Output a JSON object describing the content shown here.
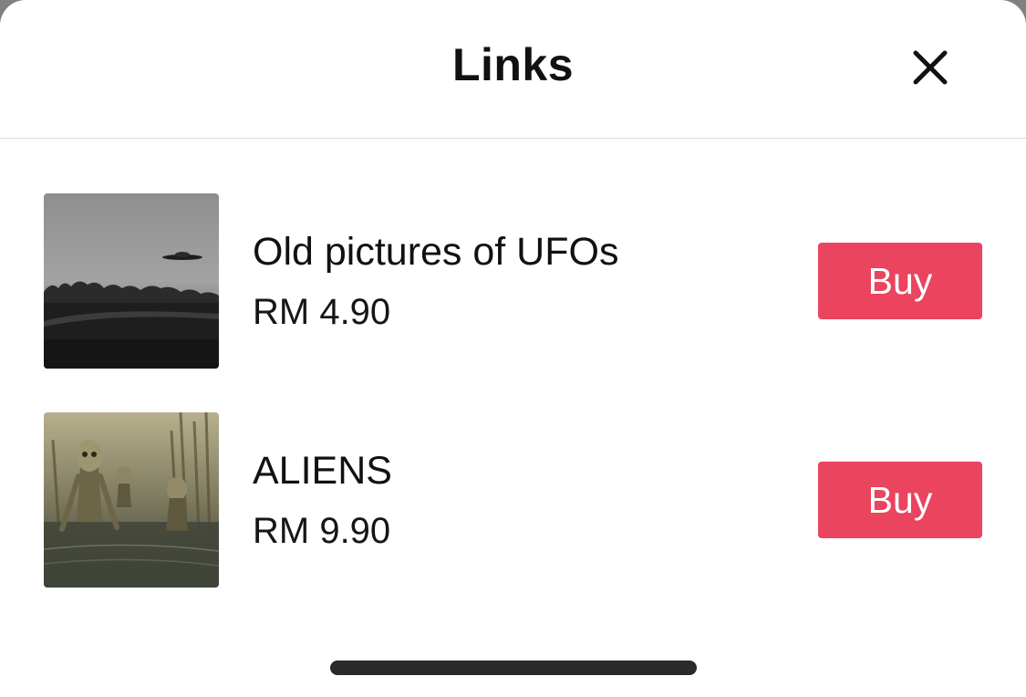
{
  "header": {
    "title": "Links"
  },
  "items": [
    {
      "name": "Old pictures of UFOs",
      "price": "RM 4.90",
      "buy_label": "Buy"
    },
    {
      "name": "ALIENS",
      "price": "RM 9.90",
      "buy_label": "Buy"
    }
  ],
  "colors": {
    "buy_button": "#ea445f",
    "background": "#ffffff",
    "divider": "#dcdcdc"
  },
  "icons": {
    "close": "close-icon"
  }
}
